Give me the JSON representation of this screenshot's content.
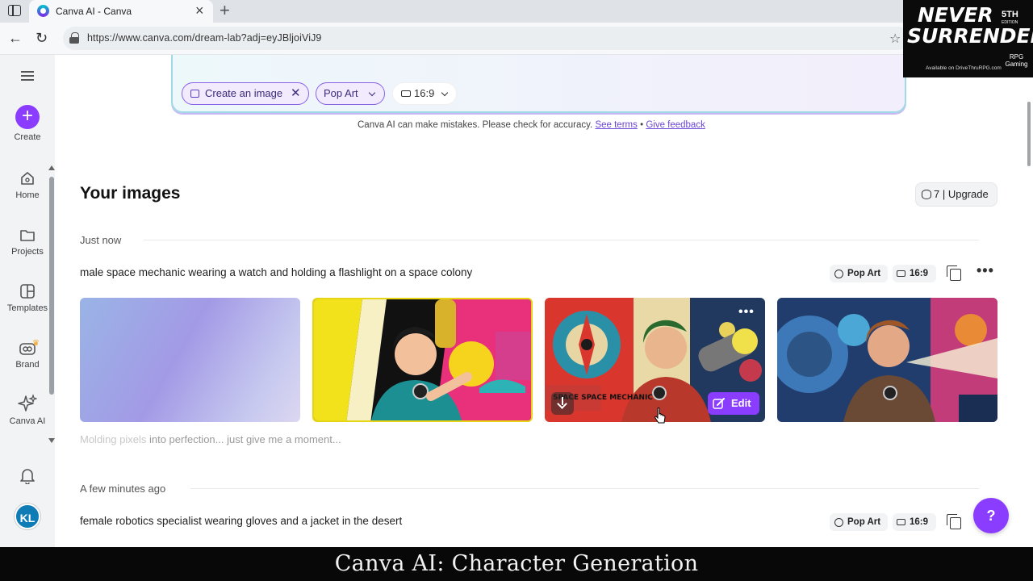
{
  "browser": {
    "tab_title": "Canva AI - Canva",
    "url": "https://www.canva.com/dream-lab?adj=eyJBljoiViJ9"
  },
  "overlay_logo": {
    "line1": "NEVER",
    "line2": "SURRENDER",
    "edition_num": "5TH",
    "edition_label": "EDITION",
    "subtitle": "RPG Gaming",
    "availability": "Available on DriveThruRPG.com"
  },
  "sidebar": {
    "create_label": "Create",
    "home_label": "Home",
    "projects_label": "Projects",
    "templates_label": "Templates",
    "brand_label": "Brand",
    "canva_ai_label": "Canva AI",
    "avatar_initials": "KL"
  },
  "prompt_bar": {
    "chip_create": "Create an image",
    "chip_style": "Pop Art",
    "chip_ratio": "16:9"
  },
  "disclaimer": {
    "text": "Canva AI can make mistakes. Please check for accuracy.",
    "terms_link": "See terms",
    "separator": "•",
    "feedback_link": "Give feedback"
  },
  "images_section": {
    "heading": "Your images",
    "upgrade_label": "7 | Upgrade",
    "groups": [
      {
        "time_label": "Just now",
        "prompt": "male space mechanic wearing a watch and holding a flashlight on a space colony",
        "style": "Pop Art",
        "ratio": "16:9",
        "loading_text_dim": "Molding pixels",
        "loading_text_rest": " into perfection... just give me a moment...",
        "edit_label": "Edit",
        "image_text": "SPACE SPACE MECHANIC"
      },
      {
        "time_label": "A few minutes ago",
        "prompt": "female robotics specialist wearing gloves and a jacket in the desert",
        "style": "Pop Art",
        "ratio": "16:9"
      }
    ]
  },
  "help_label": "?",
  "caption": "Canva AI: Character Generation",
  "colors": {
    "accent": "#8b3dff",
    "link": "#6a44d6"
  }
}
